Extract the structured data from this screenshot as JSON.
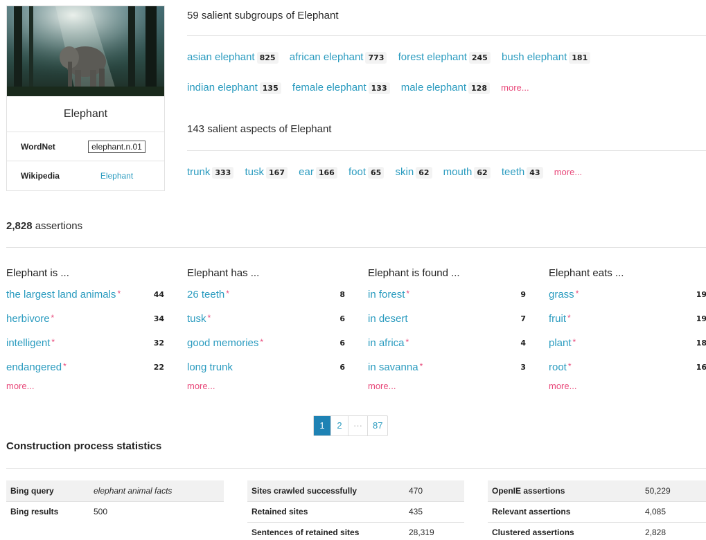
{
  "entity": {
    "title": "Elephant",
    "wordnet_label": "WordNet",
    "wordnet_value": "elephant.n.01",
    "wikipedia_label": "Wikipedia",
    "wikipedia_value": "Elephant"
  },
  "subgroups": {
    "heading": "59 salient subgroups of Elephant",
    "items": [
      {
        "label": "asian elephant",
        "count": "825"
      },
      {
        "label": "african elephant",
        "count": "773"
      },
      {
        "label": "forest elephant",
        "count": "245"
      },
      {
        "label": "bush elephant",
        "count": "181"
      },
      {
        "label": "indian elephant",
        "count": "135"
      },
      {
        "label": "female elephant",
        "count": "133"
      },
      {
        "label": "male elephant",
        "count": "128"
      }
    ],
    "more": "more..."
  },
  "aspects": {
    "heading": "143 salient aspects of Elephant",
    "items": [
      {
        "label": "trunk",
        "count": "333"
      },
      {
        "label": "tusk",
        "count": "167"
      },
      {
        "label": "ear",
        "count": "166"
      },
      {
        "label": "foot",
        "count": "65"
      },
      {
        "label": "skin",
        "count": "62"
      },
      {
        "label": "mouth",
        "count": "62"
      },
      {
        "label": "teeth",
        "count": "43"
      }
    ],
    "more": "more..."
  },
  "assertions": {
    "count": "2,828",
    "label": " assertions",
    "star": "*",
    "columns": [
      {
        "heading": "Elephant is ...",
        "rows": [
          {
            "text": "the largest land animals",
            "count": "44",
            "star": true
          },
          {
            "text": "herbivore",
            "count": "34",
            "star": true
          },
          {
            "text": "intelligent",
            "count": "32",
            "star": true
          },
          {
            "text": "endangered",
            "count": "22",
            "star": true
          }
        ],
        "more": "more..."
      },
      {
        "heading": "Elephant has ...",
        "rows": [
          {
            "text": "26 teeth",
            "count": "8",
            "star": true
          },
          {
            "text": "tusk",
            "count": "6",
            "star": true
          },
          {
            "text": "good memories",
            "count": "6",
            "star": true
          },
          {
            "text": "long trunk",
            "count": "6",
            "star": false
          }
        ],
        "more": "more..."
      },
      {
        "heading": "Elephant is found ...",
        "rows": [
          {
            "text": "in forest",
            "count": "9",
            "star": true
          },
          {
            "text": "in desert",
            "count": "7",
            "star": false
          },
          {
            "text": "in africa",
            "count": "4",
            "star": true
          },
          {
            "text": "in savanna",
            "count": "3",
            "star": true
          }
        ],
        "more": "more..."
      },
      {
        "heading": "Elephant eats ...",
        "rows": [
          {
            "text": "grass",
            "count": "19",
            "star": true
          },
          {
            "text": "fruit",
            "count": "19",
            "star": true
          },
          {
            "text": "plant",
            "count": "18",
            "star": true
          },
          {
            "text": "root",
            "count": "16",
            "star": true
          }
        ],
        "more": "more..."
      }
    ]
  },
  "pagination": {
    "pages": [
      "1",
      "2",
      "···",
      "87"
    ],
    "active": "1"
  },
  "stats": {
    "heading": "Construction process statistics",
    "tables": [
      {
        "rows": [
          {
            "label": "Bing query",
            "value": "elephant animal facts"
          },
          {
            "label": "Bing results",
            "value": "500"
          }
        ]
      },
      {
        "rows": [
          {
            "label": "Sites crawled successfully",
            "value": "470"
          },
          {
            "label": "Retained sites",
            "value": "435"
          },
          {
            "label": "Sentences of retained sites",
            "value": "28,319"
          }
        ]
      },
      {
        "rows": [
          {
            "label": "OpenIE assertions",
            "value": "50,229"
          },
          {
            "label": "Relevant assertions",
            "value": "4,085"
          },
          {
            "label": "Clustered assertions",
            "value": "2,828"
          }
        ]
      }
    ]
  },
  "colors": {
    "link": "#2a9bbf",
    "accent": "#e8497a",
    "active_page": "#1e82b4"
  }
}
